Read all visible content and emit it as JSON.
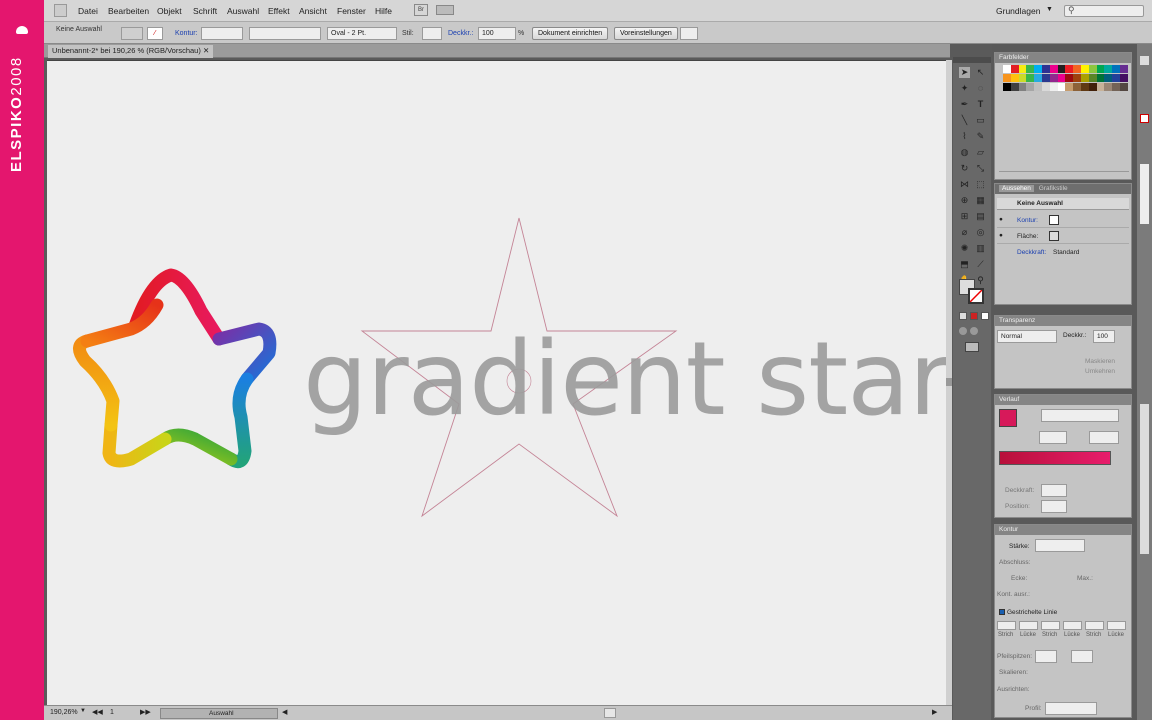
{
  "brand": {
    "bold": "ELSPIKO",
    "thin": "2008"
  },
  "menubar": {
    "items": [
      "Datei",
      "Bearbeiten",
      "Objekt",
      "Schrift",
      "Auswahl",
      "Effekt",
      "Ansicht",
      "Fenster",
      "Hilfe"
    ],
    "app_short": "Br",
    "workspace": "Grundlagen",
    "search_placeholder": ""
  },
  "control_bar": {
    "selection": "Keine Auswahl",
    "stroke_label": "Kontur:",
    "brush": "Oval - 2 Pt.",
    "style_label": "Stil:",
    "opacity_label": "Deckkr.:",
    "opacity_value": "100",
    "percent": "%",
    "doc_setup": "Dokument einrichten",
    "prefs": "Voreinstellungen"
  },
  "document": {
    "tab_title": "Unbenannt-2* bei 190,26 % (RGB/Vorschau)",
    "heading": "gradient star"
  },
  "statusbar": {
    "zoom": "190,26%",
    "page": "1",
    "tool": "Auswahl"
  },
  "panels": {
    "swatches": {
      "title": "Farbfelder"
    },
    "appearance": {
      "tabs": [
        "Aussehen",
        "Grafikstile"
      ],
      "no_selection": "Keine Auswahl",
      "stroke": "Kontur:",
      "fill": "Fläche:",
      "opacity": "Deckkraft:",
      "opacity_value": "Standard"
    },
    "transparency": {
      "title": "Transparenz",
      "mode": "Normal",
      "opacity_label": "Deckkr.:",
      "opacity_value": "100",
      "check1": "Maskieren",
      "check2": "Umkehren"
    },
    "gradient": {
      "title": "Verlauf",
      "opacity": "Deckkraft:",
      "position": "Position:",
      "color_start": "#b8103a",
      "color_end": "#e81d6c"
    },
    "stroke": {
      "title": "Kontur",
      "weight": "Stärke:",
      "cap": "Abschluss:",
      "corner": "Ecke:",
      "miter": "Max.:",
      "align": "Kont. ausr.:",
      "dashed": "Gestrichelte Linie",
      "dash_labels": [
        "Strich",
        "Lücke",
        "Strich",
        "Lücke",
        "Strich",
        "Lücke"
      ],
      "arrows": "Pfeilspitzen:",
      "scale": "Skalieren:",
      "arrow_align": "Ausrichten:",
      "profile": "Profil:"
    }
  },
  "colors": {
    "brand": "#e4166e",
    "gradient_star_text": "#9a9a9a",
    "star_outline": "#c48496"
  }
}
